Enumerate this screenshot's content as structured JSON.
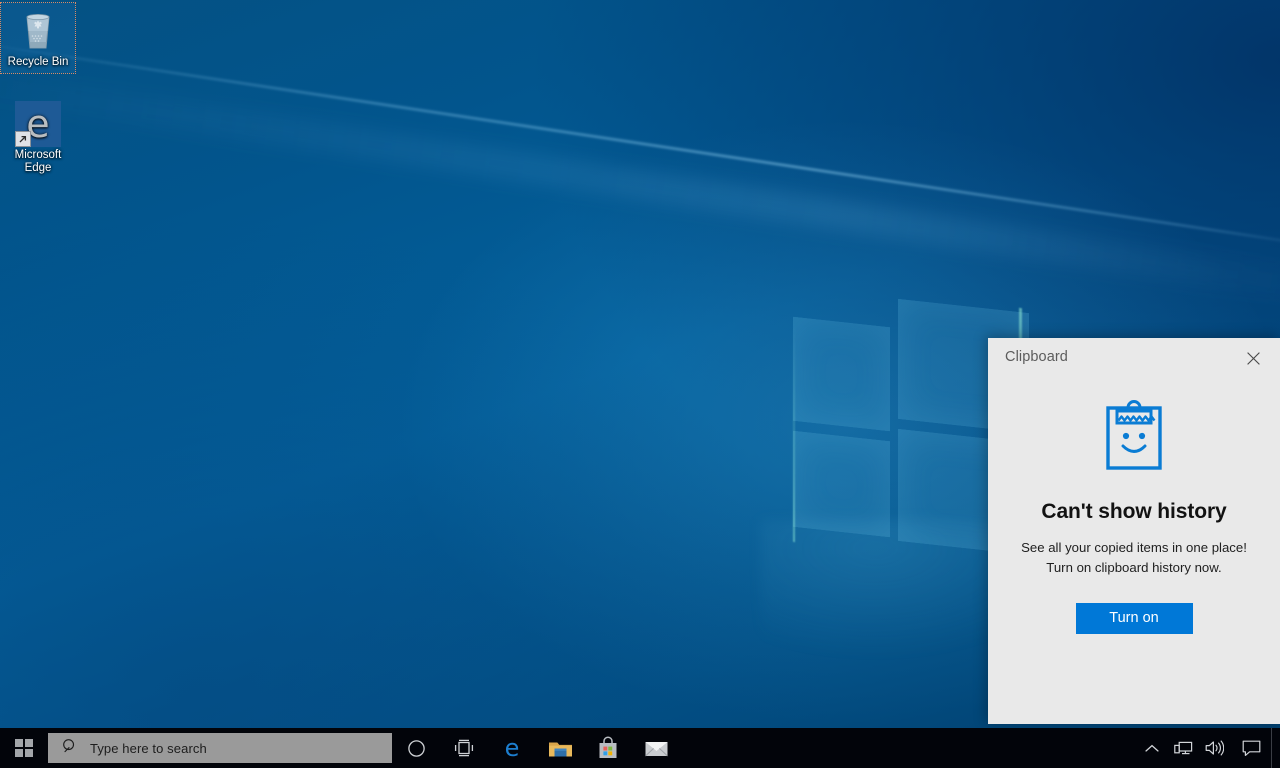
{
  "desktop": {
    "icons": [
      {
        "id": "recycle-bin",
        "label": "Recycle Bin",
        "selected": true
      },
      {
        "id": "microsoft-edge",
        "label": "Microsoft\nEdge",
        "label_line1": "Microsoft",
        "label_line2": "Edge",
        "selected": false
      }
    ]
  },
  "clipboard_panel": {
    "title": "Clipboard",
    "close_label": "Close",
    "illustration": "clipboard-smiley-icon",
    "heading": "Can't show history",
    "description_line1": "See all your copied items in one place!",
    "description_line2": "Turn on clipboard history now.",
    "action_label": "Turn on",
    "accent_color": "#0078d7",
    "background_color": "#e9e9e9"
  },
  "taskbar": {
    "start_label": "Start",
    "search": {
      "placeholder": "Type here to search",
      "value": ""
    },
    "buttons": [
      {
        "id": "cortana",
        "label": "Cortana",
        "icon": "circle-icon"
      },
      {
        "id": "task-view",
        "label": "Task View",
        "icon": "task-view-icon"
      },
      {
        "id": "microsoft-edge",
        "label": "Microsoft Edge",
        "icon": "edge-icon"
      },
      {
        "id": "file-explorer",
        "label": "File Explorer",
        "icon": "folder-icon"
      },
      {
        "id": "microsoft-store",
        "label": "Microsoft Store",
        "icon": "store-bag-icon"
      },
      {
        "id": "mail",
        "label": "Mail",
        "icon": "envelope-icon"
      }
    ],
    "tray": [
      {
        "id": "show-hidden-icons",
        "label": "Show hidden icons",
        "icon": "chevron-up-icon"
      },
      {
        "id": "network",
        "label": "Network",
        "icon": "network-monitor-icon"
      },
      {
        "id": "volume",
        "label": "Speakers",
        "icon": "speaker-icon"
      },
      {
        "id": "action-center",
        "label": "Action Center",
        "icon": "speech-bubble-icon"
      }
    ],
    "show_desktop_label": "Show desktop",
    "background_color": "#02040a",
    "search_background_color": "#9a9a9a"
  }
}
